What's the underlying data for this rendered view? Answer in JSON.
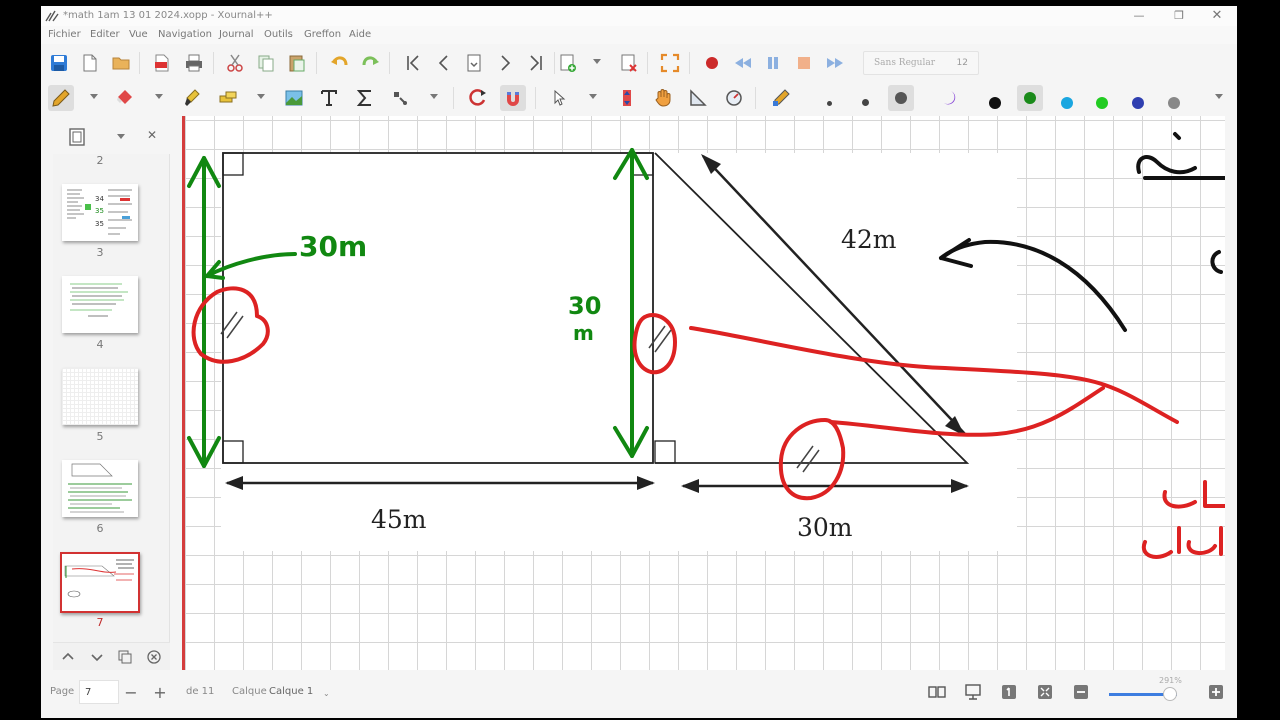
{
  "window": {
    "title": "*math 1am 13 01 2024.xopp - Xournal++",
    "controls": {
      "minimize": "—",
      "maximize": "❐",
      "close": "✕"
    }
  },
  "menu": [
    "Fichier",
    "Editer",
    "Vue",
    "Navigation",
    "Journal",
    "Outils",
    "Greffon",
    "Aide"
  ],
  "toolbar": {
    "font_name": "Sans Regular",
    "font_size": "12",
    "colors": [
      "#111111",
      "#1a8a1a",
      "#1aa6e0",
      "#22cc22",
      "#2f3fb0",
      "#888888"
    ],
    "selected_color": "#1a8a1a"
  },
  "sidebar": {
    "pages": [
      {
        "number": "2"
      },
      {
        "number": "3"
      },
      {
        "number": "4"
      },
      {
        "number": "5"
      },
      {
        "number": "6"
      },
      {
        "number": "7",
        "selected": true
      }
    ]
  },
  "canvas": {
    "labels": {
      "top_diagonal": "42m",
      "bottom_left": "45m",
      "bottom_right": "30m",
      "green_left": "30m",
      "green_mid_top": "30",
      "green_mid_bottom": "m"
    }
  },
  "status": {
    "page_label": "Page",
    "page_value": "7",
    "of_label": "de 11",
    "layer_label": "Calque",
    "layer_value": "Calque 1",
    "zoom": "291%"
  }
}
